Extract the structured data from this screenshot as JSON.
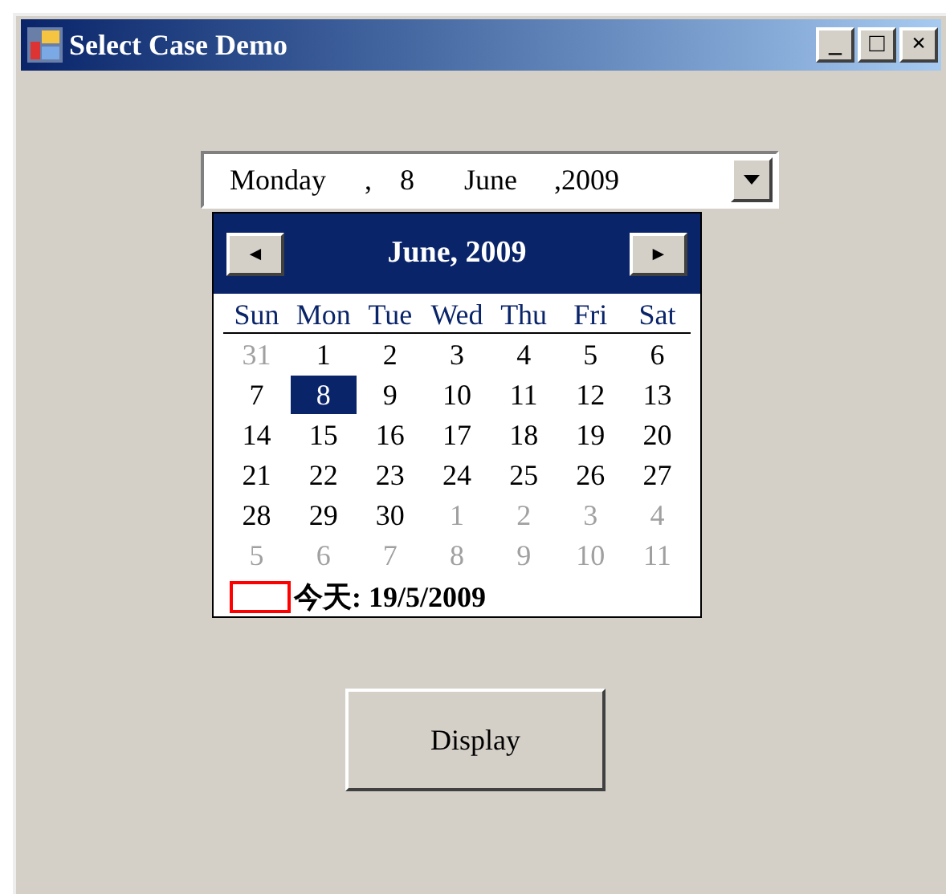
{
  "window": {
    "title": "Select Case Demo",
    "controls": [
      "_",
      "□",
      "×"
    ]
  },
  "date_field": {
    "parts": [
      "Monday",
      ",",
      "8",
      "June",
      ",2009"
    ]
  },
  "calendar": {
    "month_label": "June, 2009",
    "prev": "◄",
    "next": "►",
    "weekdays": [
      "Sun",
      "Mon",
      "Tue",
      "Wed",
      "Thu",
      "Fri",
      "Sat"
    ],
    "weeks": [
      [
        {
          "text": "31",
          "other_month": true,
          "selected": false
        },
        {
          "text": "1",
          "other_month": false,
          "selected": false
        },
        {
          "text": "2",
          "other_month": false,
          "selected": false
        },
        {
          "text": "3",
          "other_month": false,
          "selected": false
        },
        {
          "text": "4",
          "other_month": false,
          "selected": false
        },
        {
          "text": "5",
          "other_month": false,
          "selected": false
        },
        {
          "text": "6",
          "other_month": false,
          "selected": false
        }
      ],
      [
        {
          "text": "7",
          "other_month": false,
          "selected": false
        },
        {
          "text": "8",
          "other_month": false,
          "selected": true
        },
        {
          "text": "9",
          "other_month": false,
          "selected": false
        },
        {
          "text": "10",
          "other_month": false,
          "selected": false
        },
        {
          "text": "11",
          "other_month": false,
          "selected": false
        },
        {
          "text": "12",
          "other_month": false,
          "selected": false
        },
        {
          "text": "13",
          "other_month": false,
          "selected": false
        }
      ],
      [
        {
          "text": "14",
          "other_month": false,
          "selected": false
        },
        {
          "text": "15",
          "other_month": false,
          "selected": false
        },
        {
          "text": "16",
          "other_month": false,
          "selected": false
        },
        {
          "text": "17",
          "other_month": false,
          "selected": false
        },
        {
          "text": "18",
          "other_month": false,
          "selected": false
        },
        {
          "text": "19",
          "other_month": false,
          "selected": false
        },
        {
          "text": "20",
          "other_month": false,
          "selected": false
        }
      ],
      [
        {
          "text": "21",
          "other_month": false,
          "selected": false
        },
        {
          "text": "22",
          "other_month": false,
          "selected": false
        },
        {
          "text": "23",
          "other_month": false,
          "selected": false
        },
        {
          "text": "24",
          "other_month": false,
          "selected": false
        },
        {
          "text": "25",
          "other_month": false,
          "selected": false
        },
        {
          "text": "26",
          "other_month": false,
          "selected": false
        },
        {
          "text": "27",
          "other_month": false,
          "selected": false
        }
      ],
      [
        {
          "text": "28",
          "other_month": false,
          "selected": false
        },
        {
          "text": "29",
          "other_month": false,
          "selected": false
        },
        {
          "text": "30",
          "other_month": false,
          "selected": false
        },
        {
          "text": "1",
          "other_month": true,
          "selected": false
        },
        {
          "text": "2",
          "other_month": true,
          "selected": false
        },
        {
          "text": "3",
          "other_month": true,
          "selected": false
        },
        {
          "text": "4",
          "other_month": true,
          "selected": false
        }
      ],
      [
        {
          "text": "5",
          "other_month": true,
          "selected": false
        },
        {
          "text": "6",
          "other_month": true,
          "selected": false
        },
        {
          "text": "7",
          "other_month": true,
          "selected": false
        },
        {
          "text": "8",
          "other_month": true,
          "selected": false
        },
        {
          "text": "9",
          "other_month": true,
          "selected": false
        },
        {
          "text": "10",
          "other_month": true,
          "selected": false
        },
        {
          "text": "11",
          "other_month": true,
          "selected": false
        }
      ]
    ],
    "today_label": "今天: 19/5/2009"
  },
  "button": {
    "label": "Display"
  }
}
